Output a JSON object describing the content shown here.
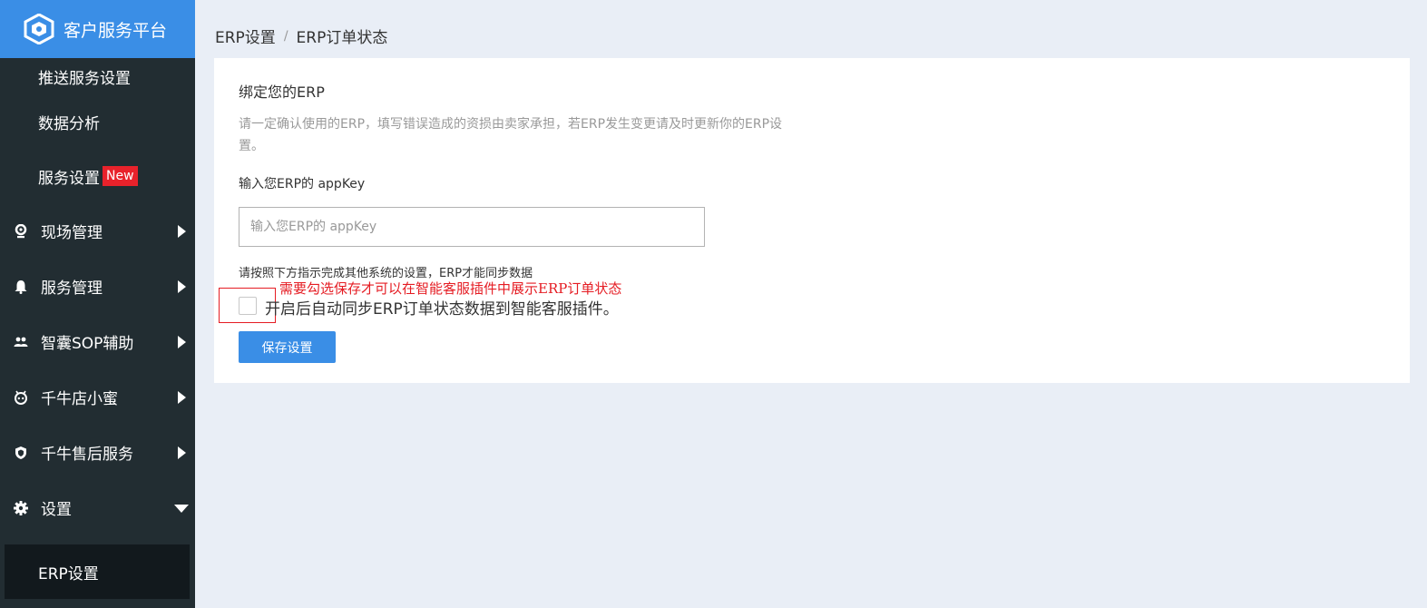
{
  "app": {
    "title": "客户服务平台",
    "brand_color": "#3a8ee6"
  },
  "sidebar": {
    "sub_items_top": [
      {
        "label": "推送服务设置"
      },
      {
        "label": "数据分析"
      },
      {
        "label": "服务设置",
        "badge": "New"
      }
    ],
    "groups": [
      {
        "label": "现场管理",
        "icon": "location-pin-icon",
        "expanded": false
      },
      {
        "label": "服务管理",
        "icon": "bell-icon",
        "expanded": false
      },
      {
        "label": "智囊SOP辅助",
        "icon": "users-icon",
        "expanded": false
      },
      {
        "label": "千牛店小蜜",
        "icon": "robot-icon",
        "expanded": false
      },
      {
        "label": "千牛售后服务",
        "icon": "shield-icon",
        "expanded": false
      },
      {
        "label": "设置",
        "icon": "gear-icon",
        "expanded": true
      }
    ],
    "active_item": {
      "label": "ERP设置"
    }
  },
  "breadcrumb": {
    "items": [
      "ERP设置",
      "ERP订单状态"
    ],
    "separator": "/"
  },
  "main": {
    "title": "绑定您的ERP",
    "description": "请一定确认使用的ERP，填写错误造成的资损由卖家承担，若ERP发生变更请及时更新你的ERP设置。",
    "appkey_label": "输入您ERP的 appKey",
    "appkey_value": "",
    "appkey_placeholder": "输入您ERP的 appKey",
    "hint": "请按照下方指示完成其他系统的设置，ERP才能同步数据",
    "annotation": "需要勾选保存才可以在智能客服插件中展示ERP订单状态",
    "checkbox_label": "开启后自动同步ERP订单状态数据到智能客服插件。",
    "checkbox_checked": false,
    "save_label": "保存设置"
  }
}
